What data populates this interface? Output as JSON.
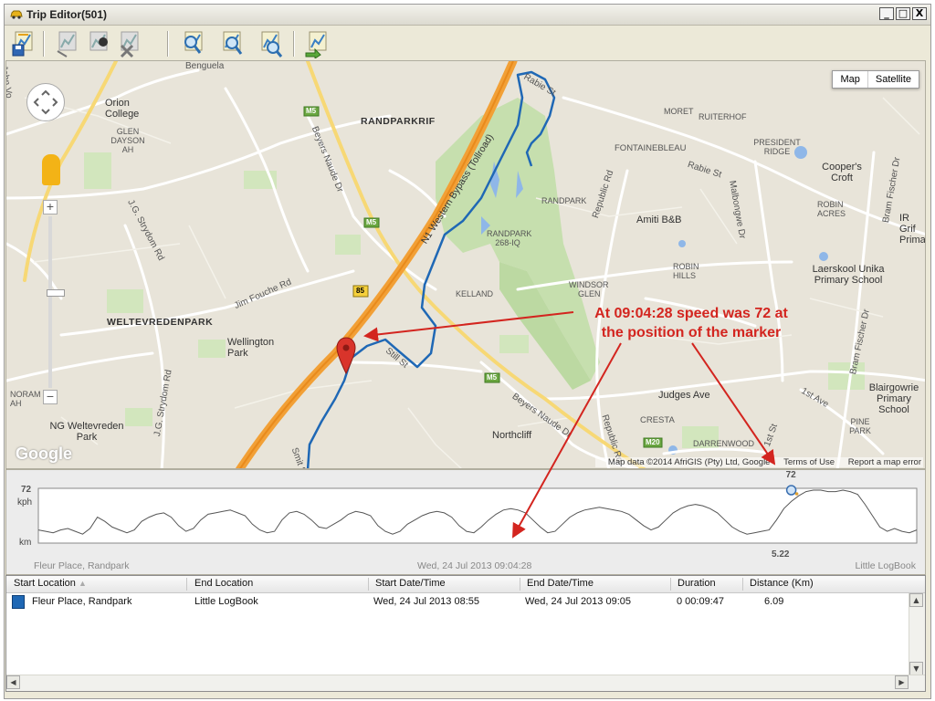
{
  "window": {
    "title": "Trip Editor(501)",
    "controls": [
      "_",
      "□",
      "X"
    ]
  },
  "toolbar": {
    "buttons": [
      {
        "name": "save-trip",
        "icon": "save-icon"
      },
      {
        "name": "cut-trip",
        "icon": "cut-icon"
      },
      {
        "name": "merge-trip",
        "icon": "merge-icon"
      },
      {
        "name": "delete-trip",
        "icon": "delete-icon"
      },
      {
        "name": "zoom-trip",
        "icon": "zoom-icon"
      },
      {
        "name": "zoom-selection",
        "icon": "zoom-select-icon"
      },
      {
        "name": "zoom-extent",
        "icon": "zoom-extent-icon"
      },
      {
        "name": "export-trip",
        "icon": "export-icon"
      }
    ]
  },
  "map": {
    "type_buttons": [
      "Map",
      "Satellite"
    ],
    "provider_logo": "Google",
    "attribution": "Map data ©2014 AfriGIS (Pty) Ltd, Google",
    "terms": "Terms of Use",
    "report": "Report a map error",
    "zoom_in": "+",
    "zoom_out": "−",
    "labels": {
      "randparkrif": "RANDPARKRIF",
      "weltevredenpark": "WELTEVREDENPARK",
      "orion_college": "Orion College",
      "glen_dayson": "GLEN DAYSON AH",
      "moret": "MORET",
      "ruiterhof": "RUITERHOF",
      "fontainebleau": "FONTAINEBLEAU",
      "president_ridge": "PRESIDENT RIDGE",
      "coopers_croft": "Cooper's Croft",
      "randpark": "RANDPARK",
      "amiti": "Amiti B&B",
      "randpark_268": "RANDPARK 268-IQ",
      "robin_acres": "ROBIN ACRES",
      "ir_grif": "IR Grif Prima",
      "kelland": "KELLAND",
      "windsor": "WINDSOR",
      "laerskool": "Laerskool Unika Primary School",
      "wellington_park": "Wellington Park",
      "blairgowrie": "Blairgowrie Primary School",
      "cresta": "CRESTA",
      "darrenwood": "DARRENWOOD",
      "northcliff": "Northcliff",
      "noram": "NORAM AH",
      "ng_welt": "NG Weltevreden Park",
      "pine_park": "PINE PARK",
      "robin_hills": "ROBIN HILLS",
      "glen": "GLEN",
      "benguela": "Benguela",
      "road_n1": "N1 Western Bypass (Tollroad)",
      "road_beyers1": "Beyers Naude Dr",
      "road_beyers2": "Beyers Naude Dr",
      "road_rabie1": "Rabie St",
      "road_rabie2": "Rabie St",
      "road_republic1": "Republic Rd",
      "road_republic2": "Republic Rd",
      "road_jim": "Jim Fouche Rd",
      "road_jg1": "J.G. Strydom Rd",
      "road_jg2": "J.G. Strydom Rd",
      "road_malb": "Malbongwe Dr",
      "road_bram1": "Bram Fischer Dr",
      "road_bram2": "Bram Fischer Dr",
      "road_judges": "Judges Ave",
      "road_1st1": "1st Ave",
      "road_1st2": "1st St",
      "road_john": "John Vo",
      "road_still": "Still St",
      "road_smit": "Smit St",
      "shield_m5a": "M5",
      "shield_m5b": "M5",
      "shield_m5c": "M5",
      "shield_85": "85",
      "shield_m20": "M20"
    }
  },
  "annotation": {
    "line1": "At 09:04:28 speed was 72 at",
    "line2": "the position of the marker"
  },
  "chart": {
    "y_top_label": "72",
    "y_unit_top": "kph",
    "y_unit_bottom": "km",
    "marker_speed": "72",
    "marker_distance": "5.22",
    "start_location": "Fleur Place, Randpark",
    "end_location": "Little LogBook",
    "marker_time": "Wed, 24 Jul 2013 09:04:28"
  },
  "chart_data": {
    "type": "line",
    "ylabel": "kph",
    "xlabel": "km",
    "x_range_km": [
      0,
      6.09
    ],
    "y_max": 72,
    "marker": {
      "x_km": 5.22,
      "y": 72
    },
    "series": [
      {
        "values": [
          16,
          14,
          12,
          16,
          18,
          14,
          10,
          18,
          34,
          28,
          20,
          16,
          12,
          16,
          28,
          34,
          38,
          40,
          34,
          22,
          14,
          18,
          30,
          38,
          40,
          42,
          44,
          40,
          36,
          24,
          16,
          12,
          14,
          30,
          40,
          42,
          38,
          30,
          20,
          18,
          24,
          30,
          38,
          42,
          40,
          36,
          22,
          14,
          10,
          14,
          24,
          30,
          36,
          40,
          42,
          40,
          34,
          22,
          14,
          12,
          20,
          30,
          38,
          44,
          46,
          44,
          40,
          30,
          20,
          12,
          14,
          24,
          34,
          40,
          44,
          46,
          48,
          46,
          44,
          42,
          38,
          30,
          22,
          16,
          20,
          30,
          40,
          46,
          50,
          52,
          50,
          46,
          40,
          30,
          20,
          14,
          10,
          12,
          14,
          16,
          30,
          46,
          56,
          64,
          70,
          72,
          72,
          70,
          70,
          72,
          70,
          66,
          52,
          36,
          20,
          14,
          18,
          14,
          12,
          16
        ]
      }
    ]
  },
  "table": {
    "columns": [
      "Start Location",
      "End Location",
      "Start Date/Time",
      "End Date/Time",
      "Duration",
      "Distance (Km)"
    ],
    "rows": [
      {
        "color": "#1f68b5",
        "start_location": "Fleur Place, Randpark",
        "end_location": "Little LogBook",
        "start_time": "Wed, 24 Jul 2013 08:55",
        "end_time": "Wed, 24 Jul 2013 09:05",
        "duration": "0 00:09:47",
        "distance": "6.09"
      }
    ]
  }
}
